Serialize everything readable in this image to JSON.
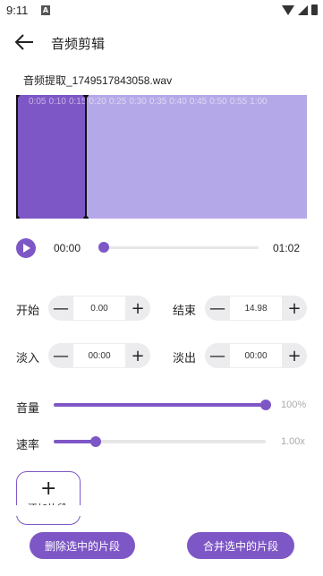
{
  "status": {
    "time": "9:11",
    "notif": "A"
  },
  "header": {
    "title": "音频剪辑"
  },
  "file": {
    "name": "音频提取_1749517843058.wav"
  },
  "waveform": {
    "ticks": [
      "0:05",
      "0:10",
      "0:15",
      "0:20",
      "0:25",
      "0:30",
      "0:35",
      "0:40",
      "0:45",
      "0:50",
      "0:55",
      "1:00"
    ],
    "selected_fraction": 0.24
  },
  "player": {
    "current": "00:00",
    "duration": "01:02",
    "progress": 0.0
  },
  "controls": {
    "start": {
      "label": "开始",
      "value": "0.00"
    },
    "end": {
      "label": "结束",
      "value": "14.98"
    },
    "fade_in": {
      "label": "淡入",
      "value": "00:00"
    },
    "fade_out": {
      "label": "淡出",
      "value": "00:00"
    },
    "minus": "—",
    "plus": "+"
  },
  "volume": {
    "label": "音量",
    "value": "100%",
    "level": 1.0
  },
  "speed": {
    "label": "速率",
    "value": "1.00x",
    "level": 0.2
  },
  "add_segment": {
    "plus": "+",
    "label": "添加片段"
  },
  "actions": {
    "delete": "删除选中的片段",
    "merge": "合并选中的片段"
  },
  "colors": {
    "accent": "#7e57c6",
    "wave_bg": "#b5a8e8"
  }
}
